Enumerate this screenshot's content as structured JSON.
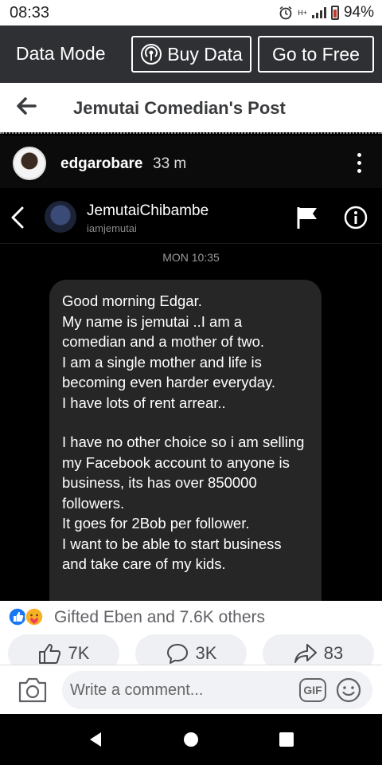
{
  "status_bar": {
    "time": "08:33",
    "battery": "94%",
    "network": "H+"
  },
  "data_bar": {
    "label": "Data Mode",
    "buy_label": "Buy Data",
    "free_label": "Go to Free"
  },
  "post_header": {
    "title": "Jemutai Comedian's Post"
  },
  "poster": {
    "name": "edgarobare",
    "time": "33 m"
  },
  "chat": {
    "name": "JemutaiChibambe",
    "handle": "iamjemutai",
    "date": "MON 10:35",
    "message_1": "Good morning Edgar.\nMy name is jemutai ..I am a comedian and a mother of two.\nI am a single mother and life is becoming even harder everyday.\nI have lots of rent arrear..",
    "message_2": "I have no other choice so i am selling my Facebook account to anyone is business, its has over 850000 followers.\nIt goes for 2Bob per follower.\nI want to be able to start business and take care of my kids."
  },
  "reactions": {
    "text": "Gifted Eben and 7.6K others"
  },
  "actions": {
    "likes": "7K",
    "comments": "3K",
    "shares": "83"
  },
  "comment_bar": {
    "placeholder": "Write a comment...",
    "gif_label": "GIF"
  },
  "colors": {
    "data_bar_bg": "#2f3034",
    "bubble_bg": "#262626",
    "like_blue": "#1877f2",
    "love_red": "#f33e58"
  },
  "icons": [
    "alarm-icon",
    "signal-icon",
    "battery-icon",
    "broadcast-icon",
    "back-arrow-icon",
    "more-vert-icon",
    "chevron-left-icon",
    "flag-icon",
    "info-icon",
    "like-reaction-icon",
    "care-reaction-icon",
    "thumbs-up-icon",
    "comment-icon",
    "share-icon",
    "camera-icon",
    "gif-icon",
    "emoji-icon",
    "nav-back-icon",
    "nav-home-icon",
    "nav-recents-icon"
  ]
}
